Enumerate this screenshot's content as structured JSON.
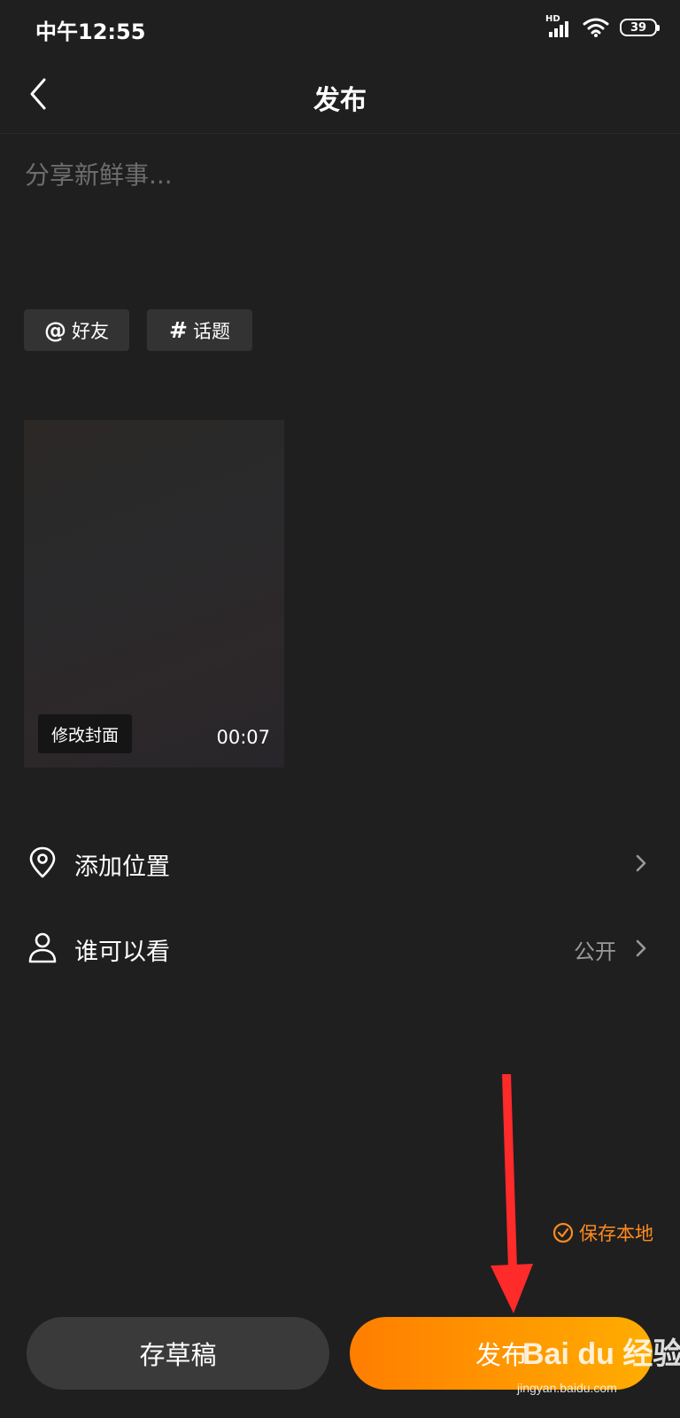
{
  "status_bar": {
    "time": "中午12:55",
    "signal_label": "HD",
    "battery": "39",
    "icons": [
      "signal-icon",
      "wifi-icon",
      "battery-icon"
    ]
  },
  "header": {
    "title": "发布",
    "back_icon": "chevron-left-icon"
  },
  "composer": {
    "placeholder": "分享新鲜事...",
    "value": ""
  },
  "chips": {
    "friend": {
      "icon": "@",
      "label": "好友"
    },
    "topic": {
      "icon": "#",
      "label": "话题"
    }
  },
  "video": {
    "edit_cover_label": "修改封面",
    "duration": "00:07"
  },
  "options": {
    "location": {
      "label": "添加位置",
      "icon": "location-pin-icon"
    },
    "visibility": {
      "label": "谁可以看",
      "value": "公开",
      "icon": "person-icon"
    }
  },
  "save_local": {
    "label": "保存本地",
    "checked": true
  },
  "actions": {
    "draft_label": "存草稿",
    "publish_label": "发布"
  },
  "watermark": {
    "logo_text": "Bai du 经验",
    "url": "jingyan.baidu.com"
  },
  "colors": {
    "background": "#1f1f1f",
    "accent": "#ff8a1f",
    "publish_gradient_start": "#ff7e00",
    "publish_gradient_end": "#ffad00",
    "annotation_arrow": "#ff2a2a"
  }
}
